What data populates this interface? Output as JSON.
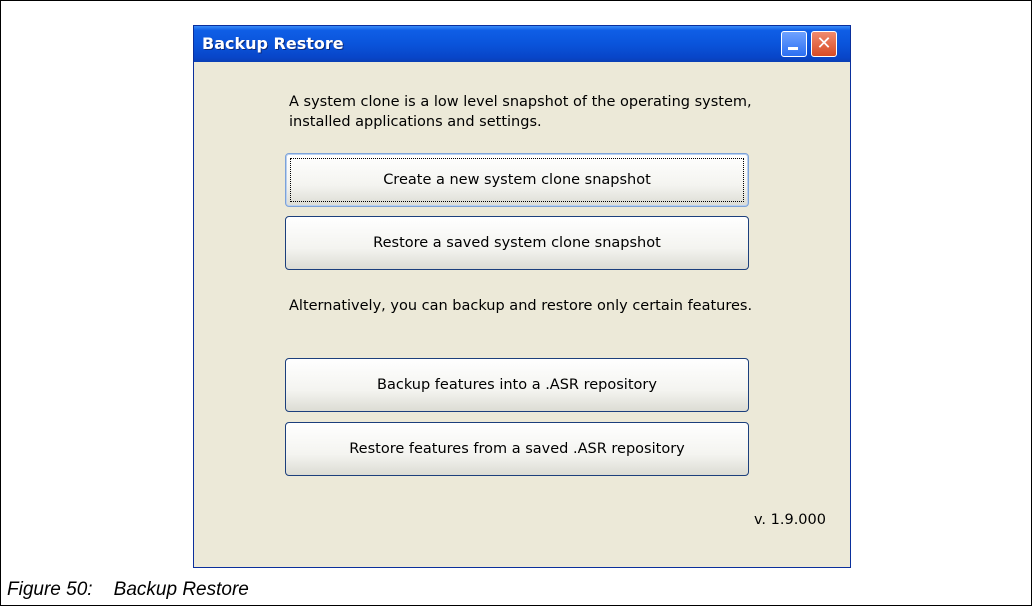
{
  "window": {
    "title": "Backup Restore",
    "minimize_icon": "minimize-icon",
    "close_icon": "close-icon",
    "close_glyph": "✕"
  },
  "content": {
    "intro_text": "A system clone is a low level snapshot of the operating system, installed applications and settings.",
    "buttons": [
      {
        "label": "Create a new system clone snapshot"
      },
      {
        "label": "Restore a saved system clone snapshot"
      },
      {
        "label": "Backup features into a .ASR repository"
      },
      {
        "label": "Restore features from a saved .ASR repository"
      }
    ],
    "alternative_text": "Alternatively, you can backup and restore only certain features.",
    "version": "v. 1.9.000"
  },
  "caption": "Figure 50:    Backup Restore",
  "colors": {
    "titlebar": "#0a54db",
    "window_bg": "#ece9d8",
    "close_button": "#d84b25"
  }
}
